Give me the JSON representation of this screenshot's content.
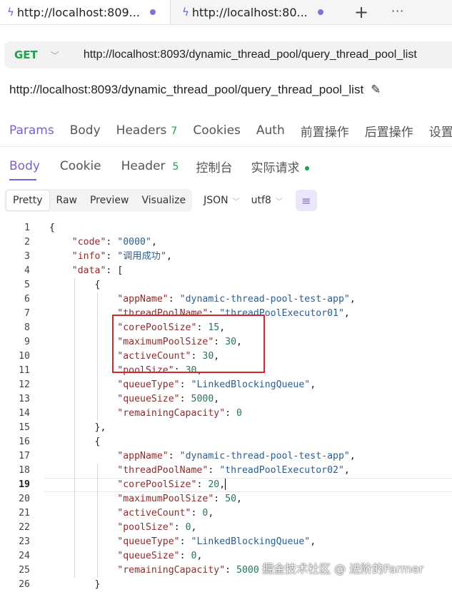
{
  "tabs": [
    {
      "label": "http://localhost:809...",
      "icon": "bolt-icon"
    },
    {
      "label": "http://localhost:80...",
      "icon": "bolt-icon"
    }
  ],
  "tab_actions": {
    "new_tab": "+",
    "more": "···"
  },
  "request": {
    "method": "GET",
    "url": "http://localhost:8093/dynamic_thread_pool/query_thread_pool_list",
    "name": "http://localhost:8093/dynamic_thread_pool/query_thread_pool_list"
  },
  "request_tabs": [
    {
      "label": "Params"
    },
    {
      "label": "Body"
    },
    {
      "label": "Headers",
      "count": "7"
    },
    {
      "label": "Cookies"
    },
    {
      "label": "Auth"
    },
    {
      "label": "前置操作"
    },
    {
      "label": "后置操作"
    },
    {
      "label": "设置"
    }
  ],
  "response_tabs": [
    {
      "label": "Body"
    },
    {
      "label": "Cookie"
    },
    {
      "label": "Header",
      "count": "5"
    },
    {
      "label": "控制台"
    },
    {
      "label": "实际请求"
    }
  ],
  "view_modes": [
    "Pretty",
    "Raw",
    "Preview",
    "Visualize"
  ],
  "format": "JSON",
  "encoding": "utf8",
  "colors": {
    "accent": "#7b5fd0",
    "method": "#1aa34a",
    "highlight_box": "#d9232d"
  },
  "code_lines": [
    {
      "n": "1",
      "tokens": [
        [
          "p",
          "{"
        ]
      ]
    },
    {
      "n": "2",
      "tokens": [
        [
          "p",
          "    "
        ],
        [
          "k",
          "\"code\""
        ],
        [
          "p",
          ": "
        ],
        [
          "s",
          "\"0000\""
        ],
        [
          "p",
          ","
        ]
      ]
    },
    {
      "n": "3",
      "tokens": [
        [
          "p",
          "    "
        ],
        [
          "k",
          "\"info\""
        ],
        [
          "p",
          ": "
        ],
        [
          "s",
          "\"调用成功\""
        ],
        [
          "p",
          ","
        ]
      ]
    },
    {
      "n": "4",
      "tokens": [
        [
          "p",
          "    "
        ],
        [
          "k",
          "\"data\""
        ],
        [
          "p",
          ": ["
        ]
      ]
    },
    {
      "n": "5",
      "tokens": [
        [
          "p",
          "        {"
        ]
      ]
    },
    {
      "n": "6",
      "tokens": [
        [
          "p",
          "            "
        ],
        [
          "k",
          "\"appName\""
        ],
        [
          "p",
          ": "
        ],
        [
          "s",
          "\"dynamic-thread-pool-test-app\""
        ],
        [
          "p",
          ","
        ]
      ]
    },
    {
      "n": "7",
      "tokens": [
        [
          "p",
          "            "
        ],
        [
          "k",
          "\"threadPoolName\""
        ],
        [
          "p",
          ": "
        ],
        [
          "s",
          "\"threadPoolExecutor01\""
        ],
        [
          "p",
          ","
        ]
      ]
    },
    {
      "n": "8",
      "tokens": [
        [
          "p",
          "            "
        ],
        [
          "k",
          "\"corePoolSize\""
        ],
        [
          "p",
          ": "
        ],
        [
          "n",
          "15"
        ],
        [
          "p",
          ","
        ]
      ]
    },
    {
      "n": "9",
      "tokens": [
        [
          "p",
          "            "
        ],
        [
          "k",
          "\"maximumPoolSize\""
        ],
        [
          "p",
          ": "
        ],
        [
          "n",
          "30"
        ],
        [
          "p",
          ","
        ]
      ]
    },
    {
      "n": "10",
      "tokens": [
        [
          "p",
          "            "
        ],
        [
          "k",
          "\"activeCount\""
        ],
        [
          "p",
          ": "
        ],
        [
          "n",
          "30"
        ],
        [
          "p",
          ","
        ]
      ]
    },
    {
      "n": "11",
      "tokens": [
        [
          "p",
          "            "
        ],
        [
          "k",
          "\"poolSize\""
        ],
        [
          "p",
          ": "
        ],
        [
          "n",
          "30"
        ],
        [
          "p",
          ","
        ]
      ]
    },
    {
      "n": "12",
      "tokens": [
        [
          "p",
          "            "
        ],
        [
          "k",
          "\"queueType\""
        ],
        [
          "p",
          ": "
        ],
        [
          "s",
          "\"LinkedBlockingQueue\""
        ],
        [
          "p",
          ","
        ]
      ]
    },
    {
      "n": "13",
      "tokens": [
        [
          "p",
          "            "
        ],
        [
          "k",
          "\"queueSize\""
        ],
        [
          "p",
          ": "
        ],
        [
          "n",
          "5000"
        ],
        [
          "p",
          ","
        ]
      ]
    },
    {
      "n": "14",
      "tokens": [
        [
          "p",
          "            "
        ],
        [
          "k",
          "\"remainingCapacity\""
        ],
        [
          "p",
          ": "
        ],
        [
          "n",
          "0"
        ]
      ]
    },
    {
      "n": "15",
      "tokens": [
        [
          "p",
          "        },"
        ]
      ]
    },
    {
      "n": "16",
      "tokens": [
        [
          "p",
          "        {"
        ]
      ]
    },
    {
      "n": "17",
      "tokens": [
        [
          "p",
          "            "
        ],
        [
          "k",
          "\"appName\""
        ],
        [
          "p",
          ": "
        ],
        [
          "s",
          "\"dynamic-thread-pool-test-app\""
        ],
        [
          "p",
          ","
        ]
      ]
    },
    {
      "n": "18",
      "tokens": [
        [
          "p",
          "            "
        ],
        [
          "k",
          "\"threadPoolName\""
        ],
        [
          "p",
          ": "
        ],
        [
          "s",
          "\"threadPoolExecutor02\""
        ],
        [
          "p",
          ","
        ]
      ]
    },
    {
      "n": "19",
      "tokens": [
        [
          "p",
          "            "
        ],
        [
          "k",
          "\"corePoolSize\""
        ],
        [
          "p",
          ": "
        ],
        [
          "n",
          "20"
        ],
        [
          "p",
          ","
        ]
      ],
      "current": true
    },
    {
      "n": "20",
      "tokens": [
        [
          "p",
          "            "
        ],
        [
          "k",
          "\"maximumPoolSize\""
        ],
        [
          "p",
          ": "
        ],
        [
          "n",
          "50"
        ],
        [
          "p",
          ","
        ]
      ]
    },
    {
      "n": "21",
      "tokens": [
        [
          "p",
          "            "
        ],
        [
          "k",
          "\"activeCount\""
        ],
        [
          "p",
          ": "
        ],
        [
          "n",
          "0"
        ],
        [
          "p",
          ","
        ]
      ]
    },
    {
      "n": "22",
      "tokens": [
        [
          "p",
          "            "
        ],
        [
          "k",
          "\"poolSize\""
        ],
        [
          "p",
          ": "
        ],
        [
          "n",
          "0"
        ],
        [
          "p",
          ","
        ]
      ]
    },
    {
      "n": "23",
      "tokens": [
        [
          "p",
          "            "
        ],
        [
          "k",
          "\"queueType\""
        ],
        [
          "p",
          ": "
        ],
        [
          "s",
          "\"LinkedBlockingQueue\""
        ],
        [
          "p",
          ","
        ]
      ]
    },
    {
      "n": "24",
      "tokens": [
        [
          "p",
          "            "
        ],
        [
          "k",
          "\"queueSize\""
        ],
        [
          "p",
          ": "
        ],
        [
          "n",
          "0"
        ],
        [
          "p",
          ","
        ]
      ]
    },
    {
      "n": "25",
      "tokens": [
        [
          "p",
          "            "
        ],
        [
          "k",
          "\"remainingCapacity\""
        ],
        [
          "p",
          ": "
        ],
        [
          "n",
          "5000"
        ]
      ]
    },
    {
      "n": "26",
      "tokens": [
        [
          "p",
          "        }"
        ]
      ]
    }
  ],
  "watermark": "掘金技术社区 @ 进阶的Farmer"
}
